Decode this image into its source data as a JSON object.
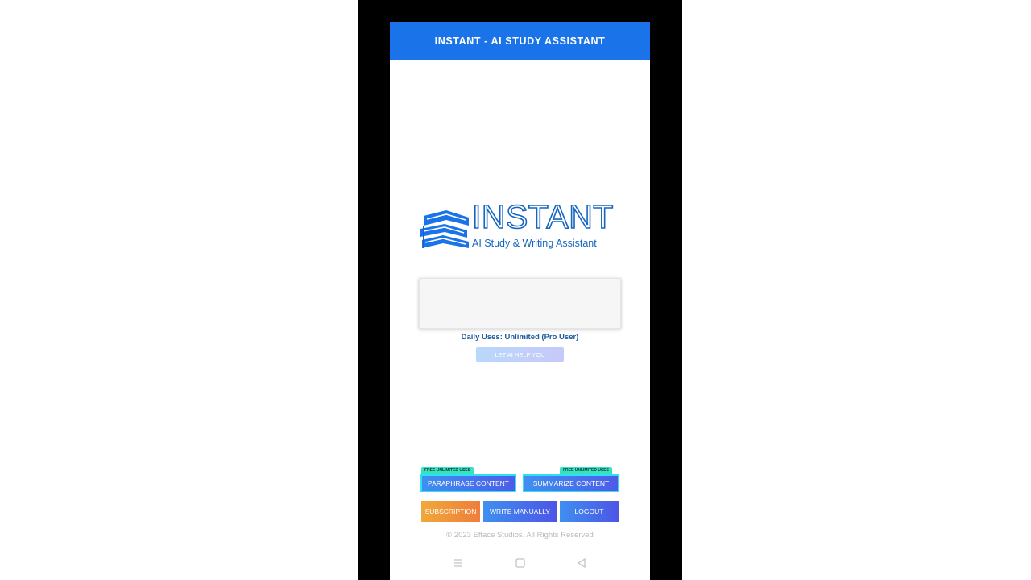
{
  "header": {
    "title": "INSTANT - AI STUDY ASSISTANT"
  },
  "logo": {
    "wordmark": "INSTANT",
    "tagline": "AI Study & Writing Assistant",
    "brand_color": "#1565c0"
  },
  "input": {
    "value": ""
  },
  "status": {
    "daily_uses": "Daily Uses: Unlimited (Pro User)"
  },
  "help_button": {
    "label": "LET AI HELP YOU"
  },
  "tools": {
    "paraphrase": {
      "badge": "FREE UNLIMITED USES",
      "label": "PARAPHRASE CONTENT"
    },
    "summarize": {
      "badge": "FREE UNLIMITED USES",
      "label": "SUMMARIZE CONTENT"
    }
  },
  "actions": {
    "subscription": "SUBSCRIPTION",
    "write_manually": "WRITE MANUALLY",
    "logout": "LOGOUT"
  },
  "footer": {
    "copyright": "© 2023 Efface Studios. All Rights Reserved"
  },
  "nav_bar": {
    "icons": [
      "menu-icon",
      "home-square-icon",
      "back-triangle-icon"
    ]
  },
  "colors": {
    "header_bg": "#1a73e8",
    "primary_gradient": [
      "#3f8ff0",
      "#4d5ce8"
    ],
    "subscription_gradient": [
      "#f0a83a",
      "#ef7e3a"
    ],
    "badge": "#38e1c0"
  }
}
